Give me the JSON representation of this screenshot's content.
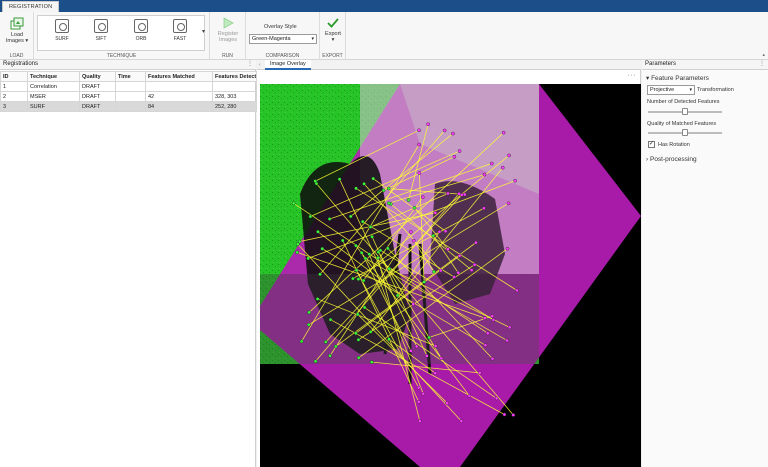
{
  "window": {
    "tab_label": "REGISTRATION"
  },
  "ribbon": {
    "load": {
      "button_label_line1": "Load",
      "button_label_line2": "Images",
      "section": "LOAD"
    },
    "technique": {
      "items": [
        "SURF",
        "SIFT",
        "ORB",
        "FAST"
      ],
      "section": "TECHNIQUE",
      "more_glyph": "▾"
    },
    "run": {
      "button_label_line1": "Register",
      "button_label_line2": "Images",
      "section": "RUN"
    },
    "comparison": {
      "overlay_label": "Overlay Style",
      "overlay_value": "Green-Magenta",
      "section": "COMPARISON"
    },
    "export": {
      "button_label": "Export",
      "section": "EXPORT"
    }
  },
  "registrations": {
    "title": "Registrations",
    "columns": [
      "ID",
      "Technique",
      "Quality",
      "Time",
      "Features Matched",
      "Features Detect"
    ],
    "rows": [
      [
        "1",
        "Correlation",
        "DRAFT",
        "",
        "",
        ""
      ],
      [
        "2",
        "MSER",
        "DRAFT",
        "",
        "42",
        "328, 303"
      ],
      [
        "3",
        "SURF",
        "DRAFT",
        "",
        "84",
        "252, 280"
      ]
    ],
    "selected_row": 2
  },
  "viewer": {
    "tab_label": "Image Overlay",
    "more_glyph": "···"
  },
  "parameters": {
    "title": "Parameters",
    "feature_section": "Feature Parameters",
    "transformation_value": "Projective",
    "transformation_label": "Transformation",
    "detected_label": "Number of Detected Features",
    "detected_level": 0.5,
    "quality_label": "Quality of Matched Features",
    "quality_level": 0.5,
    "rotation_label": "Has Rotation",
    "rotation_checked": true,
    "postproc_section": "Post-processing"
  },
  "colors": {
    "accent": "#1c4f8a",
    "green": "#1fd31f",
    "magenta": "#c318c3",
    "match_line": "#ffff33"
  }
}
